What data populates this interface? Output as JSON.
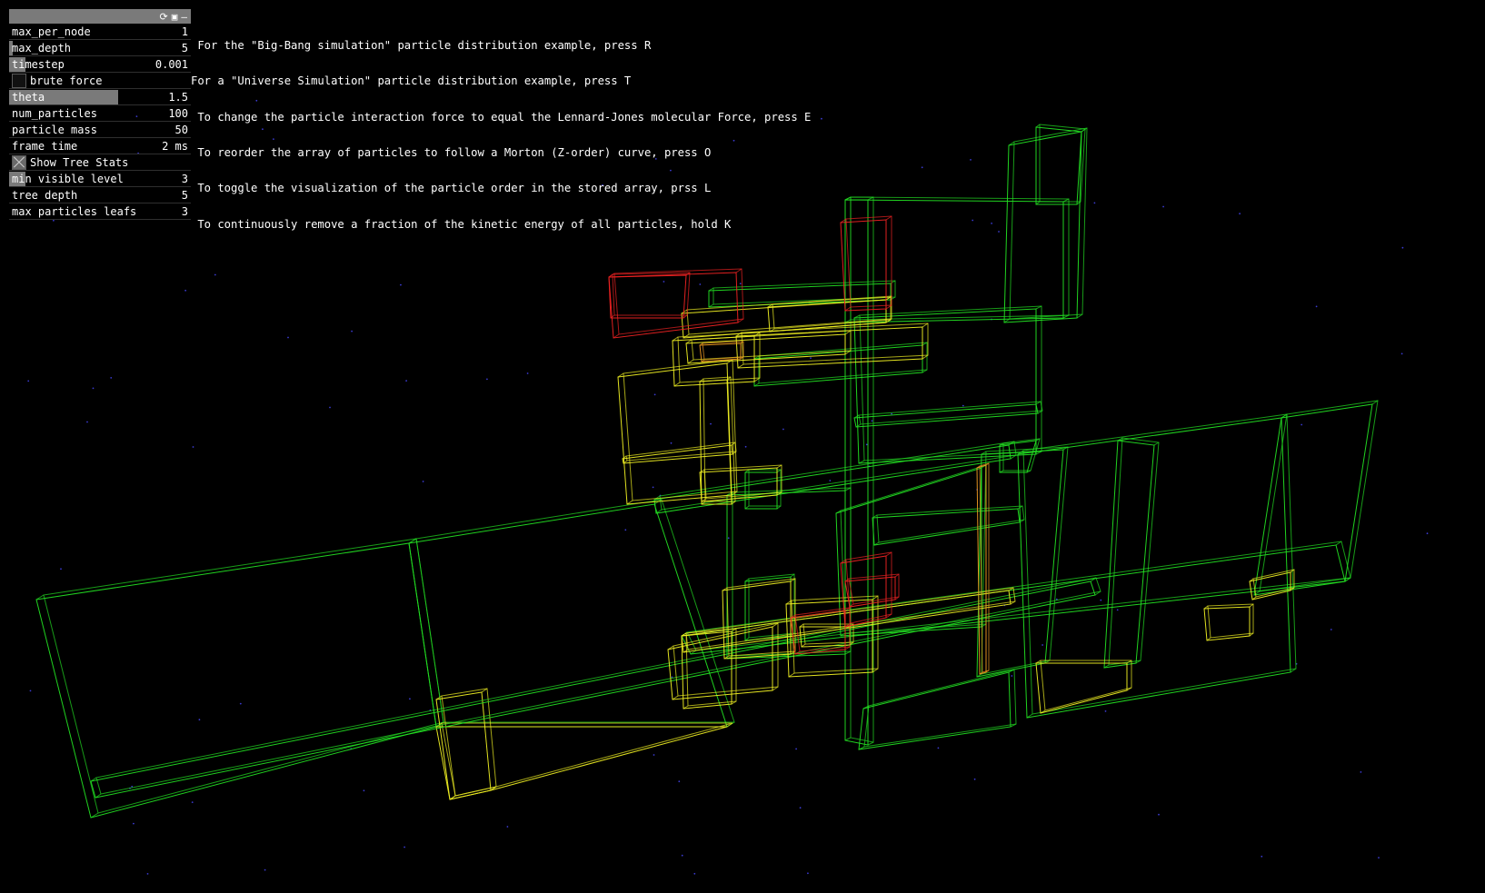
{
  "gui": {
    "header_icons": [
      "refresh-icon",
      "save-icon",
      "minimize-icon"
    ],
    "header_glyphs": {
      "refresh": "⟳",
      "save": "▣",
      "minimize": "–"
    },
    "rows": [
      {
        "label": "max_per_node",
        "value": "1",
        "kind": "slider",
        "fill": 0.0
      },
      {
        "label": "max_depth",
        "value": "5",
        "kind": "slider",
        "fill": 0.02
      },
      {
        "label": "timestep",
        "value": "0.001",
        "kind": "slider",
        "fill": 0.09
      },
      {
        "label": "brute force",
        "value": "",
        "kind": "toggle",
        "checked": false
      },
      {
        "label": "theta",
        "value": "1.5",
        "kind": "slider",
        "fill": 0.6
      },
      {
        "label": "num_particles",
        "value": "100",
        "kind": "slider",
        "fill": 0.0
      },
      {
        "label": "particle mass",
        "value": "50",
        "kind": "slider",
        "fill": 0.0
      },
      {
        "label": "frame time",
        "value": "2 ms",
        "kind": "readout",
        "fill": 0.0
      },
      {
        "label": "Show Tree Stats",
        "value": "",
        "kind": "toggle",
        "checked": true
      },
      {
        "label": "min visible level",
        "value": "3",
        "kind": "slider",
        "fill": 0.09
      },
      {
        "label": "tree depth",
        "value": "5",
        "kind": "readout",
        "fill": 0.0
      },
      {
        "label": "max particles leafs",
        "value": "3",
        "kind": "readout",
        "fill": 0.0
      }
    ]
  },
  "help_lines": [
    " For the \"Big-Bang simulation\" particle distribution example, press R",
    "For a \"Universe Simulation\" particle distribution example, press T",
    " To change the particle interaction force to equal the Lennard-Jones molecular Force, press E",
    " To reorder the array of particles to follow a Morton (Z-order) curve, press O",
    " To toggle the visualization of the particle order in the stored array, prss L",
    " To continuously remove a fraction of the kinetic energy of all particles, hold K"
  ],
  "colors": {
    "background": "#000000",
    "level_green": "#22dd22",
    "level_lime": "#88ee22",
    "level_yellow": "#eeee22",
    "level_orange": "#ee9922",
    "level_red": "#ee2222",
    "particle": "#3a3ad0"
  }
}
